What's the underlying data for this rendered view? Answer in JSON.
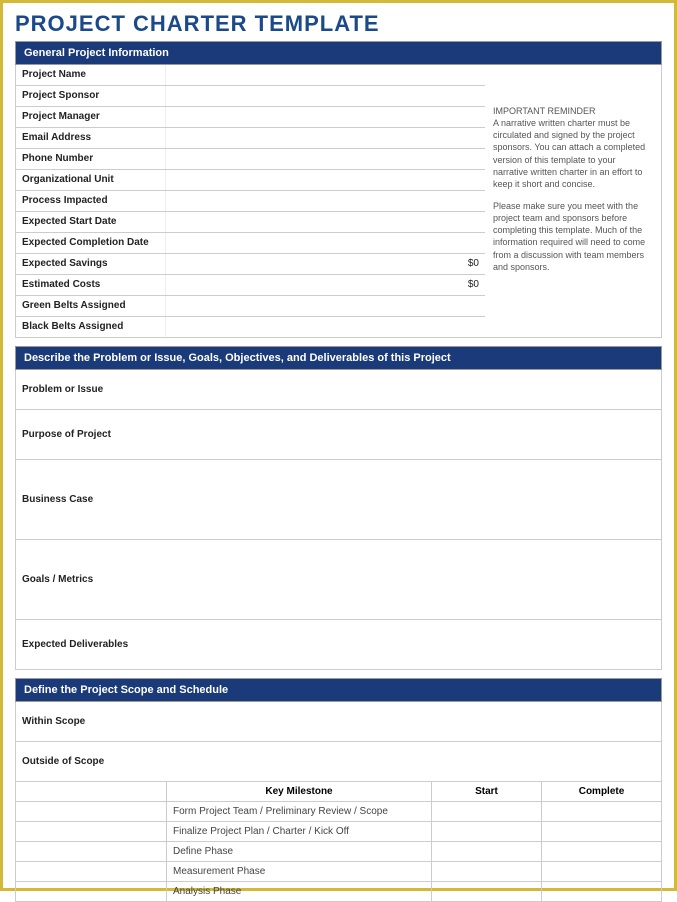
{
  "title": "PROJECT CHARTER TEMPLATE",
  "sections": {
    "general": "General Project Information",
    "describe": "Describe the Problem or Issue, Goals, Objectives, and Deliverables of this Project",
    "scope": "Define the Project Scope and Schedule"
  },
  "info_rows": [
    {
      "label": "Project Name",
      "value": ""
    },
    {
      "label": "Project Sponsor",
      "value": ""
    },
    {
      "label": "Project Manager",
      "value": ""
    },
    {
      "label": "Email Address",
      "value": ""
    },
    {
      "label": "Phone Number",
      "value": ""
    },
    {
      "label": "Organizational Unit",
      "value": ""
    },
    {
      "label": "Process Impacted",
      "value": ""
    },
    {
      "label": "Expected Start Date",
      "value": ""
    },
    {
      "label": "Expected Completion Date",
      "value": ""
    },
    {
      "label": "Expected Savings",
      "value": "$0"
    },
    {
      "label": "Estimated Costs",
      "value": "$0"
    },
    {
      "label": "Green Belts Assigned",
      "value": ""
    },
    {
      "label": "Black Belts Assigned",
      "value": ""
    }
  ],
  "reminder": {
    "heading": "IMPORTANT REMINDER",
    "p1": "A narrative written charter must be circulated and signed by the project sponsors. You can attach a completed version of this template to your narrative written charter in an effort to keep it short and concise.",
    "p2": "Please make sure you meet with the project team and sponsors before completing this template. Much of the information required will need to come from a discussion with team members and sponsors."
  },
  "describe_rows": [
    {
      "label": "Problem or Issue",
      "h": "h-small"
    },
    {
      "label": "Purpose of Project",
      "h": "h-med"
    },
    {
      "label": "Business Case",
      "h": "h-large"
    },
    {
      "label": "Goals / Metrics",
      "h": "h-large"
    },
    {
      "label": "Expected Deliverables",
      "h": "h-med"
    }
  ],
  "scope_rows": [
    {
      "label": "Within Scope",
      "h": "h-small"
    },
    {
      "label": "Outside of Scope",
      "h": "h-small"
    }
  ],
  "milestone_headers": {
    "c1": "",
    "c2": "Key Milestone",
    "c3": "Start",
    "c4": "Complete"
  },
  "milestones": [
    "Form Project Team / Preliminary Review / Scope",
    "Finalize Project Plan / Charter / Kick Off",
    "Define Phase",
    "Measurement Phase",
    "Analysis Phase"
  ]
}
